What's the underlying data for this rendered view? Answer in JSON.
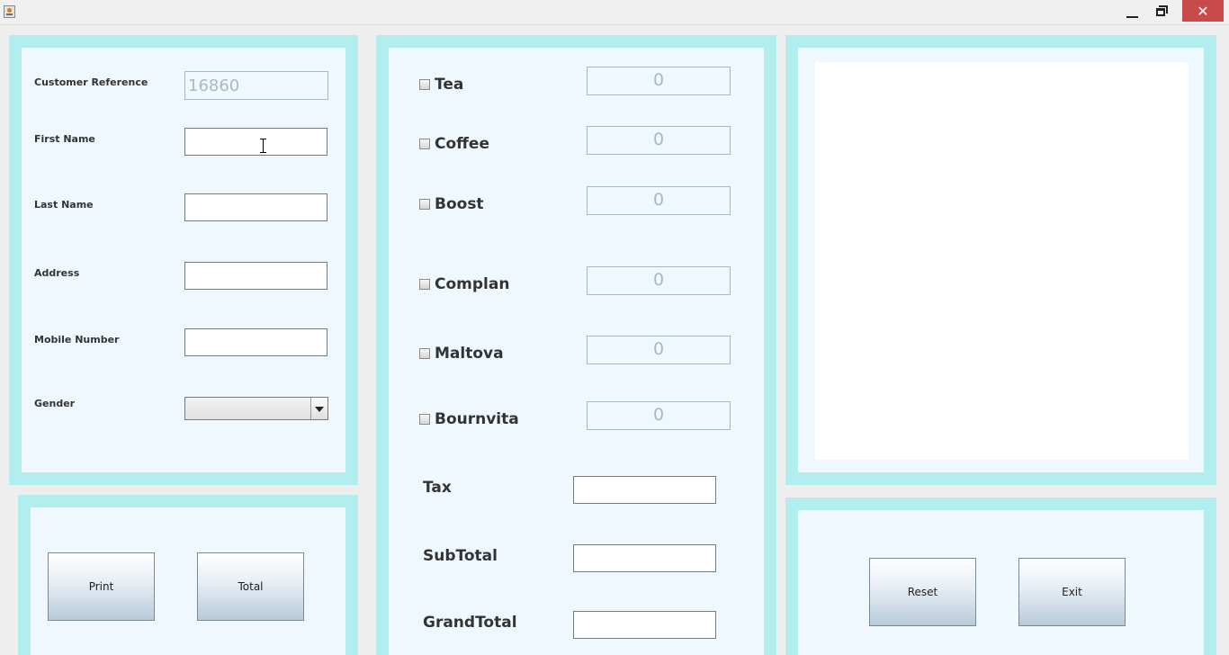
{
  "window": {
    "minimize_icon": "minimize-icon",
    "maximize_icon": "maximize-icon",
    "close_glyph": "✕"
  },
  "customer": {
    "reference_label": "Customer Reference",
    "reference_value": "16860",
    "first_name_label": "First Name",
    "last_name_label": "Last Name",
    "address_label": "Address",
    "mobile_label": "Mobile Number",
    "gender_label": "Gender"
  },
  "items": [
    {
      "label": "Tea",
      "qty": "0"
    },
    {
      "label": "Coffee",
      "qty": "0"
    },
    {
      "label": "Boost",
      "qty": "0"
    },
    {
      "label": "Complan",
      "qty": "0"
    },
    {
      "label": "Maltova",
      "qty": "0"
    },
    {
      "label": "Bournvita",
      "qty": "0"
    }
  ],
  "totals": {
    "tax_label": "Tax",
    "subtotal_label": "SubTotal",
    "grandtotal_label": "GrandTotal"
  },
  "buttons": {
    "print": "Print",
    "total": "Total",
    "reset": "Reset",
    "exit": "Exit"
  },
  "colors": {
    "panel_border": "#b2eeee",
    "panel_fill": "#f0f8ff"
  }
}
